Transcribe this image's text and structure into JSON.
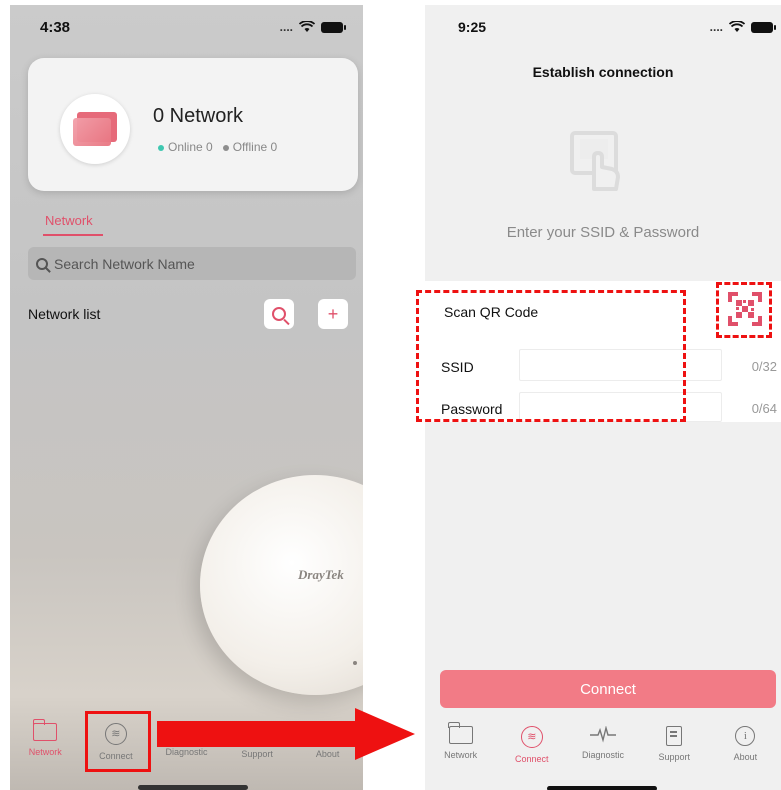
{
  "left_screen": {
    "status_time": "4:38",
    "network_card": {
      "title": "0 Network",
      "online_label": "Online 0",
      "offline_label": "Offline 0",
      "online_color": "#3ec7b0",
      "offline_color": "#8e8e8e"
    },
    "tab_label": "Network",
    "search": {
      "placeholder": "Search Network Name"
    },
    "network_list_label": "Network list",
    "add_button_label": "+",
    "device_brand": "DrayTek",
    "tabbar": [
      {
        "label": "Network",
        "icon": "folder-icon",
        "active": true
      },
      {
        "label": "Connect",
        "icon": "wifi-icon",
        "active": false
      },
      {
        "label": "Diagnostic",
        "icon": "pulse-icon",
        "active": false
      },
      {
        "label": "Support",
        "icon": "document-icon",
        "active": false
      },
      {
        "label": "About",
        "icon": "info-icon",
        "active": false
      }
    ]
  },
  "right_screen": {
    "status_time": "9:25",
    "title": "Establish connection",
    "subtitle": "Enter your SSID & Password",
    "scan_qr_label": "Scan QR Code",
    "ssid": {
      "label": "SSID",
      "value": "",
      "counter": "0/32"
    },
    "password": {
      "label": "Password",
      "value": "",
      "counter": "0/64"
    },
    "connect_button_label": "Connect",
    "tabbar": [
      {
        "label": "Network",
        "icon": "folder-icon",
        "active": false
      },
      {
        "label": "Connect",
        "icon": "wifi-icon",
        "active": true
      },
      {
        "label": "Diagnostic",
        "icon": "pulse-icon",
        "active": false
      },
      {
        "label": "Support",
        "icon": "document-icon",
        "active": false
      },
      {
        "label": "About",
        "icon": "info-icon",
        "active": false
      }
    ]
  },
  "colors": {
    "accent": "#e0506a",
    "highlight": "#ee1111",
    "connect_button": "#f27b86"
  }
}
